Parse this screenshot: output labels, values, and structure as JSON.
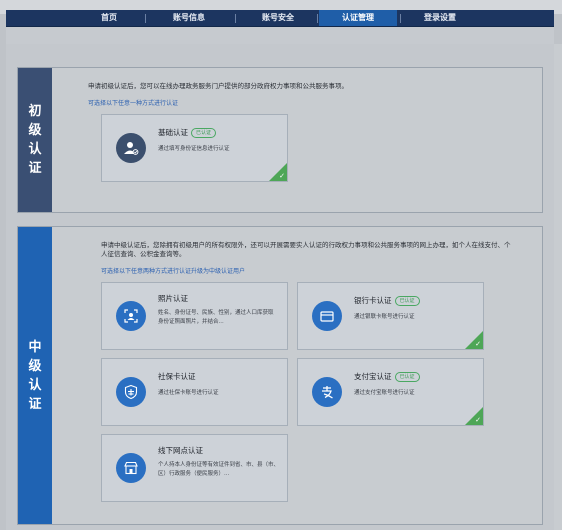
{
  "nav": {
    "items": [
      "首页",
      "账号信息",
      "账号安全",
      "认证管理",
      "登录设置"
    ],
    "active_index": 3
  },
  "primary": {
    "side_label": [
      "初",
      "级",
      "认",
      "证"
    ],
    "intro": "申请初级认证后，您可以在线办理政务服务门户提供的部分政府权力事项和公共服务事项。",
    "link": "可选择以下任意一种方式进行认证",
    "card": {
      "title": "基础认证",
      "badge": "已认证",
      "desc": "通过填写身份证信息进行认证",
      "icon": "user-verify-icon",
      "verified": true
    }
  },
  "intermediate": {
    "side_label": [
      "中",
      "级",
      "认",
      "证"
    ],
    "intro": "申请中级认证后，您除拥有初级用户的所有权限外，还可以开展需要实人认证的行政权力事项和公共服务事项的网上办理，如个人在线支付、个人征信查询、公积金查询等。",
    "link": "可选择以下任意两种方式进行认证升级为中级认证用户",
    "cards": [
      {
        "title": "照片认证",
        "badge": "",
        "desc": "姓名、身份证号、民族、性别，通过人口库获取身份证照面照片，并结合...",
        "icon": "photo-id-icon",
        "verified": false
      },
      {
        "title": "银行卡认证",
        "badge": "已认证",
        "desc": "通过银联卡账号进行认证",
        "icon": "bank-card-icon",
        "verified": true
      },
      {
        "title": "社保卡认证",
        "badge": "",
        "desc": "通过社保卡账号进行认证",
        "icon": "social-security-icon",
        "verified": false
      },
      {
        "title": "支付宝认证",
        "badge": "已认证",
        "desc": "通过支付宝账号进行认证",
        "icon": "alipay-icon",
        "verified": true
      },
      {
        "title": "线下网点认证",
        "badge": "",
        "desc": "个人持本人身份证等有效证件到省、市、县（市、区）行政服务（便民服务）...",
        "icon": "offline-outlet-icon",
        "verified": false
      }
    ]
  },
  "colors": {
    "nav_bg": "#1c3560",
    "nav_active": "#1f5ea8",
    "primary_side": "#3a4f73",
    "intermediate_side": "#1f63b3",
    "icon_blue": "#2a6fc2",
    "icon_dark": "#3b4f6d",
    "verified_green": "#4ea657"
  }
}
